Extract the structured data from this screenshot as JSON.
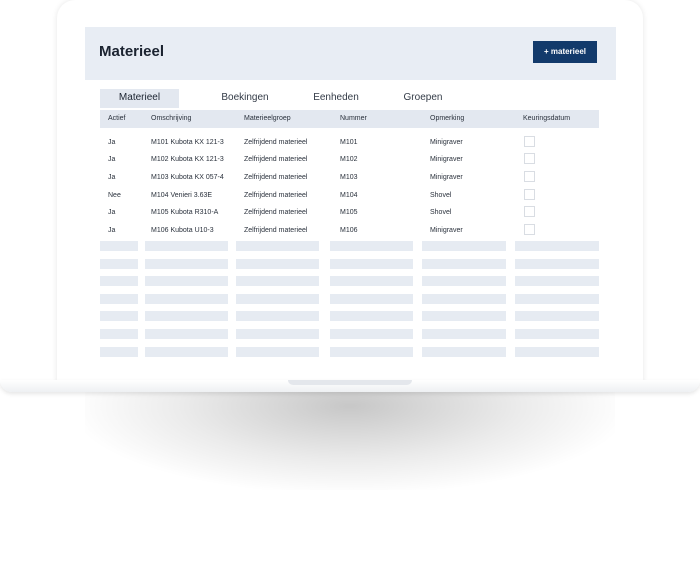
{
  "header": {
    "title": "Materieel",
    "add_button_label": "+ materieel"
  },
  "tabs": [
    {
      "label": "Materieel",
      "active": true
    },
    {
      "label": "Boekingen",
      "active": false
    },
    {
      "label": "Eenheden",
      "active": false
    },
    {
      "label": "Groepen",
      "active": false
    }
  ],
  "table": {
    "columns": [
      "Actief",
      "Omschrijving",
      "Materieelgroep",
      "Nummer",
      "Opmerking",
      "Keuringsdatum"
    ],
    "rows": [
      {
        "actief": "Ja",
        "omschrijving": "M101 Kubota KX 121-3",
        "materieelgroep": "Zelfrijdend materieel",
        "nummer": "M101",
        "opmerking": "Minigraver",
        "keuringsdatum_checked": false
      },
      {
        "actief": "Ja",
        "omschrijving": "M102 Kubota KX 121-3",
        "materieelgroep": "Zelfrijdend materieel",
        "nummer": "M102",
        "opmerking": "Minigraver",
        "keuringsdatum_checked": false
      },
      {
        "actief": "Ja",
        "omschrijving": "M103 Kubota KX 057-4",
        "materieelgroep": "Zelfrijdend materieel",
        "nummer": "M103",
        "opmerking": "Minigraver",
        "keuringsdatum_checked": false
      },
      {
        "actief": "Nee",
        "omschrijving": "M104 Venieri 3.63E",
        "materieelgroep": "Zelfrijdend materieel",
        "nummer": "M104",
        "opmerking": "Shovel",
        "keuringsdatum_checked": false
      },
      {
        "actief": "Ja",
        "omschrijving": "M105 Kubota R310-A",
        "materieelgroep": "Zelfrijdend materieel",
        "nummer": "M105",
        "opmerking": "Shovel",
        "keuringsdatum_checked": false
      },
      {
        "actief": "Ja",
        "omschrijving": "M106 Kubota U10-3",
        "materieelgroep": "Zelfrijdend materieel",
        "nummer": "M106",
        "opmerking": "Minigraver",
        "keuringsdatum_checked": false
      }
    ]
  },
  "colors": {
    "header_bg": "#e8edf4",
    "accent_button": "#123a6b",
    "placeholder": "#e6ebf2"
  }
}
